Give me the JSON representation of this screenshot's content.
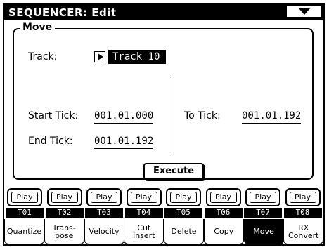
{
  "window": {
    "title": "SEQUENCER: Edit"
  },
  "group": {
    "label": "Move"
  },
  "track_field": {
    "label": "Track:",
    "value": "Track 10"
  },
  "start_tick": {
    "label": "Start Tick:",
    "value": "001.01.000"
  },
  "end_tick": {
    "label": "End Tick:",
    "value": "001.01.192"
  },
  "to_tick": {
    "label": "To Tick:",
    "value": "001.01.192"
  },
  "execute_label": "Execute",
  "tracks": [
    {
      "play": "Play",
      "name": "T01"
    },
    {
      "play": "Play",
      "name": "T02"
    },
    {
      "play": "Play",
      "name": "T03"
    },
    {
      "play": "Play",
      "name": "T04"
    },
    {
      "play": "Play",
      "name": "T05"
    },
    {
      "play": "Play",
      "name": "T06"
    },
    {
      "play": "Play",
      "name": "T07"
    },
    {
      "play": "Play",
      "name": "T08"
    }
  ],
  "tabs": [
    {
      "label": "Quantize",
      "active": false
    },
    {
      "label": "Trans-\npose",
      "active": false
    },
    {
      "label": "Velocity",
      "active": false
    },
    {
      "label": "Cut\nInsert",
      "active": false
    },
    {
      "label": "Delete",
      "active": false
    },
    {
      "label": "Copy",
      "active": false
    },
    {
      "label": "Move",
      "active": true
    },
    {
      "label": "RX\nConvert",
      "active": false
    }
  ],
  "icons": {
    "menu": "triangle-down-icon",
    "track_select": "triangle-right-icon"
  }
}
